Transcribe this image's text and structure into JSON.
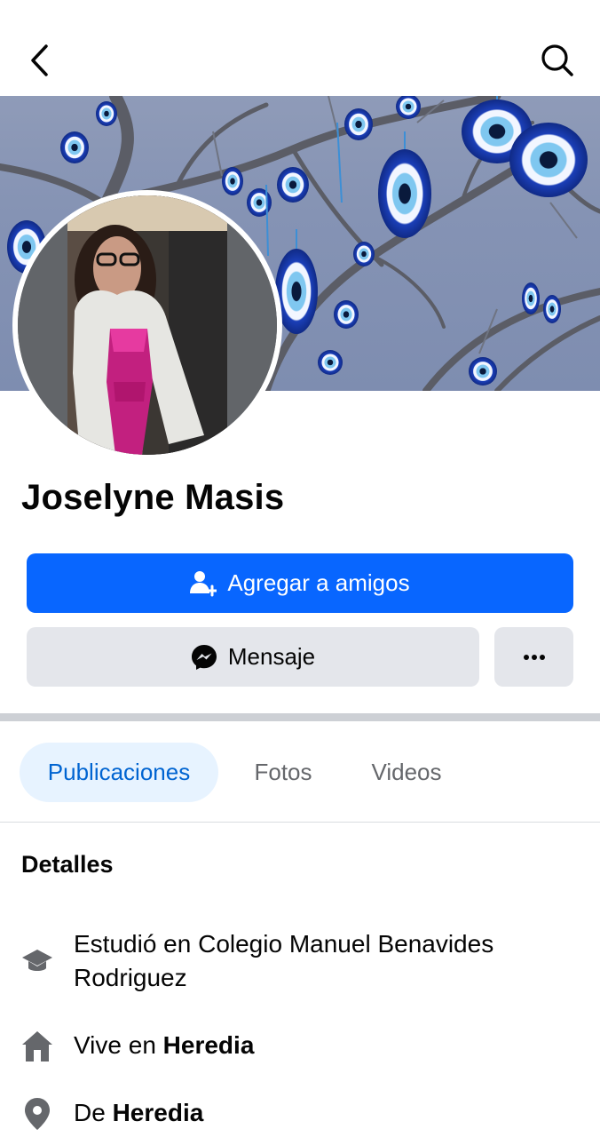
{
  "profile": {
    "name": "Joselyne Masis"
  },
  "actions": {
    "add_friend_label": "Agregar a amigos",
    "message_label": "Mensaje",
    "more_label": "···"
  },
  "tabs": [
    {
      "label": "Publicaciones",
      "active": true
    },
    {
      "label": "Fotos",
      "active": false
    },
    {
      "label": "Videos",
      "active": false
    }
  ],
  "details": {
    "title": "Detalles",
    "items": [
      {
        "icon": "graduation-cap-icon",
        "prefix": "Estudió en Colegio Manuel Benavides Rodriguez",
        "bold": ""
      },
      {
        "icon": "home-icon",
        "prefix": "Vive en ",
        "bold": "Heredia"
      },
      {
        "icon": "location-pin-icon",
        "prefix": "De ",
        "bold": "Heredia"
      }
    ]
  },
  "colors": {
    "primary": "#0866ff",
    "secondary_bg": "#e4e6eb",
    "tab_active_bg": "#e7f3ff",
    "tab_active_text": "#0064d1",
    "muted_text": "#65676b",
    "icon_gray": "#65676b"
  }
}
